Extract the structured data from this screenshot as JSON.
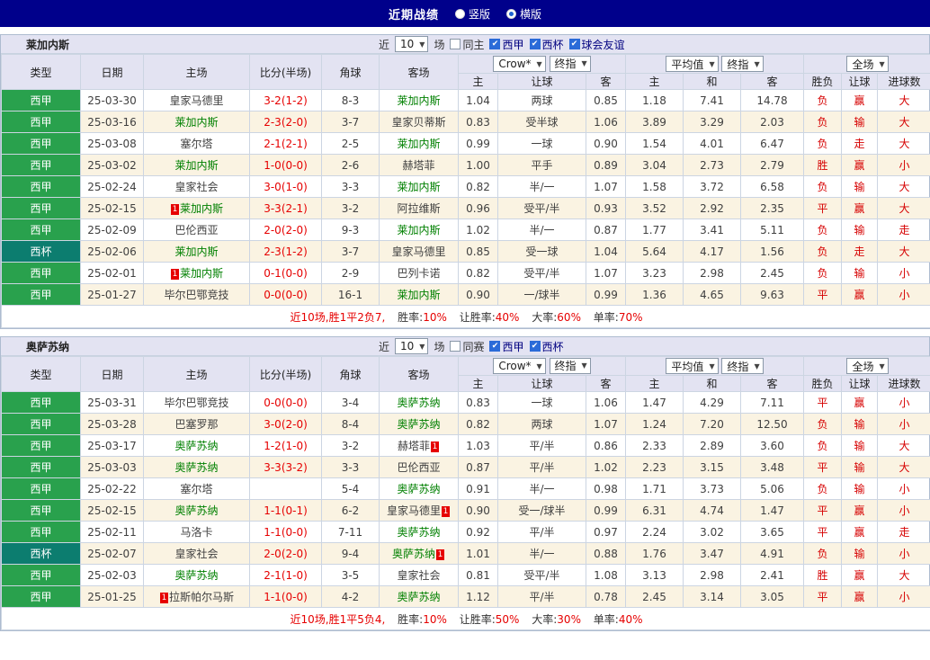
{
  "top_bar": {
    "title": "近期战绩",
    "radio_options": [
      {
        "label": "竖版",
        "selected": false
      },
      {
        "label": "横版",
        "selected": true
      }
    ]
  },
  "icons": {
    "chevron_down": "▼",
    "check": "✔"
  },
  "controls": {
    "recent_prefix": "近",
    "recent_value": "10",
    "recent_suffix": "场",
    "provider_label": "Crow*",
    "final_label": "终指",
    "average_label": "平均值",
    "scope_label": "全场"
  },
  "columns": [
    "类型",
    "日期",
    "主场",
    "比分(半场)",
    "角球",
    "客场",
    "主",
    "让球",
    "客",
    "主",
    "和",
    "客",
    "胜负",
    "让球",
    "进球数"
  ],
  "sections": [
    {
      "team": "莱加内斯",
      "same_label": "同主",
      "leagues": [
        "西甲",
        "西杯",
        "球会友谊"
      ],
      "rows": [
        {
          "league": "西甲",
          "cup": false,
          "date": "25-03-30",
          "home": "皇家马德里",
          "home_focal": false,
          "home_card": "",
          "score": "3-2(1-2)",
          "corners": "8-3",
          "away": "莱加内斯",
          "away_focal": true,
          "away_card": "",
          "odds": [
            "1.04",
            "两球",
            "0.85"
          ],
          "avg": [
            "1.18",
            "7.41",
            "14.78"
          ],
          "outcome": [
            "负",
            "赢",
            "大"
          ]
        },
        {
          "league": "西甲",
          "cup": false,
          "date": "25-03-16",
          "home": "莱加内斯",
          "home_focal": true,
          "home_card": "",
          "score": "2-3(2-0)",
          "corners": "3-7",
          "away": "皇家贝蒂斯",
          "away_focal": false,
          "away_card": "",
          "odds": [
            "0.83",
            "受半球",
            "1.06"
          ],
          "avg": [
            "3.89",
            "3.29",
            "2.03"
          ],
          "outcome": [
            "负",
            "输",
            "大"
          ]
        },
        {
          "league": "西甲",
          "cup": false,
          "date": "25-03-08",
          "home": "塞尔塔",
          "home_focal": false,
          "home_card": "",
          "score": "2-1(2-1)",
          "corners": "2-5",
          "away": "莱加内斯",
          "away_focal": true,
          "away_card": "",
          "odds": [
            "0.99",
            "一球",
            "0.90"
          ],
          "avg": [
            "1.54",
            "4.01",
            "6.47"
          ],
          "outcome": [
            "负",
            "走",
            "大"
          ]
        },
        {
          "league": "西甲",
          "cup": false,
          "date": "25-03-02",
          "home": "莱加内斯",
          "home_focal": true,
          "home_card": "",
          "score": "1-0(0-0)",
          "corners": "2-6",
          "away": "赫塔菲",
          "away_focal": false,
          "away_card": "",
          "odds": [
            "1.00",
            "平手",
            "0.89"
          ],
          "avg": [
            "3.04",
            "2.73",
            "2.79"
          ],
          "outcome": [
            "胜",
            "赢",
            "小"
          ]
        },
        {
          "league": "西甲",
          "cup": false,
          "date": "25-02-24",
          "home": "皇家社会",
          "home_focal": false,
          "home_card": "",
          "score": "3-0(1-0)",
          "corners": "3-3",
          "away": "莱加内斯",
          "away_focal": true,
          "away_card": "",
          "odds": [
            "0.82",
            "半/一",
            "1.07"
          ],
          "avg": [
            "1.58",
            "3.72",
            "6.58"
          ],
          "outcome": [
            "负",
            "输",
            "大"
          ]
        },
        {
          "league": "西甲",
          "cup": false,
          "date": "25-02-15",
          "home": "莱加内斯",
          "home_focal": true,
          "home_card": "1",
          "score": "3-3(2-1)",
          "corners": "3-2",
          "away": "阿拉维斯",
          "away_focal": false,
          "away_card": "",
          "odds": [
            "0.96",
            "受平/半",
            "0.93"
          ],
          "avg": [
            "3.52",
            "2.92",
            "2.35"
          ],
          "outcome": [
            "平",
            "赢",
            "大"
          ]
        },
        {
          "league": "西甲",
          "cup": false,
          "date": "25-02-09",
          "home": "巴伦西亚",
          "home_focal": false,
          "home_card": "",
          "score": "2-0(2-0)",
          "corners": "9-3",
          "away": "莱加内斯",
          "away_focal": true,
          "away_card": "",
          "odds": [
            "1.02",
            "半/一",
            "0.87"
          ],
          "avg": [
            "1.77",
            "3.41",
            "5.11"
          ],
          "outcome": [
            "负",
            "输",
            "走"
          ]
        },
        {
          "league": "西杯",
          "cup": true,
          "date": "25-02-06",
          "home": "莱加内斯",
          "home_focal": true,
          "home_card": "",
          "score": "2-3(1-2)",
          "corners": "3-7",
          "away": "皇家马德里",
          "away_focal": false,
          "away_card": "",
          "odds": [
            "0.85",
            "受一球",
            "1.04"
          ],
          "avg": [
            "5.64",
            "4.17",
            "1.56"
          ],
          "outcome": [
            "负",
            "走",
            "大"
          ]
        },
        {
          "league": "西甲",
          "cup": false,
          "date": "25-02-01",
          "home": "莱加内斯",
          "home_focal": true,
          "home_card": "1",
          "score": "0-1(0-0)",
          "corners": "2-9",
          "away": "巴列卡诺",
          "away_focal": false,
          "away_card": "",
          "odds": [
            "0.82",
            "受平/半",
            "1.07"
          ],
          "avg": [
            "3.23",
            "2.98",
            "2.45"
          ],
          "outcome": [
            "负",
            "输",
            "小"
          ]
        },
        {
          "league": "西甲",
          "cup": false,
          "date": "25-01-27",
          "home": "毕尔巴鄂竞技",
          "home_focal": false,
          "home_card": "",
          "score": "0-0(0-0)",
          "corners": "16-1",
          "away": "莱加内斯",
          "away_focal": true,
          "away_card": "",
          "odds": [
            "0.90",
            "一/球半",
            "0.99"
          ],
          "avg": [
            "1.36",
            "4.65",
            "9.63"
          ],
          "outcome": [
            "平",
            "赢",
            "小"
          ]
        }
      ],
      "summary": {
        "record": "近10场,胜1平2负7,",
        "items": [
          {
            "label": "胜率:",
            "value": "10%"
          },
          {
            "label": "让胜率:",
            "value": "40%"
          },
          {
            "label": "大率:",
            "value": "60%"
          },
          {
            "label": "单率:",
            "value": "70%"
          }
        ]
      }
    },
    {
      "team": "奥萨苏纳",
      "same_label": "同赛",
      "leagues": [
        "西甲",
        "西杯"
      ],
      "rows": [
        {
          "league": "西甲",
          "cup": false,
          "date": "25-03-31",
          "home": "毕尔巴鄂竞技",
          "home_focal": false,
          "home_card": "",
          "score": "0-0(0-0)",
          "corners": "3-4",
          "away": "奥萨苏纳",
          "away_focal": true,
          "away_card": "",
          "odds": [
            "0.83",
            "一球",
            "1.06"
          ],
          "avg": [
            "1.47",
            "4.29",
            "7.11"
          ],
          "outcome": [
            "平",
            "赢",
            "小"
          ]
        },
        {
          "league": "西甲",
          "cup": false,
          "date": "25-03-28",
          "home": "巴塞罗那",
          "home_focal": false,
          "home_card": "",
          "score": "3-0(2-0)",
          "corners": "8-4",
          "away": "奥萨苏纳",
          "away_focal": true,
          "away_card": "",
          "odds": [
            "0.82",
            "两球",
            "1.07"
          ],
          "avg": [
            "1.24",
            "7.20",
            "12.50"
          ],
          "outcome": [
            "负",
            "输",
            "小"
          ]
        },
        {
          "league": "西甲",
          "cup": false,
          "date": "25-03-17",
          "home": "奥萨苏纳",
          "home_focal": true,
          "home_card": "",
          "score": "1-2(1-0)",
          "corners": "3-2",
          "away": "赫塔菲",
          "away_focal": false,
          "away_card": "1",
          "odds": [
            "1.03",
            "平/半",
            "0.86"
          ],
          "avg": [
            "2.33",
            "2.89",
            "3.60"
          ],
          "outcome": [
            "负",
            "输",
            "大"
          ]
        },
        {
          "league": "西甲",
          "cup": false,
          "date": "25-03-03",
          "home": "奥萨苏纳",
          "home_focal": true,
          "home_card": "",
          "score": "3-3(3-2)",
          "corners": "3-3",
          "away": "巴伦西亚",
          "away_focal": false,
          "away_card": "",
          "odds": [
            "0.87",
            "平/半",
            "1.02"
          ],
          "avg": [
            "2.23",
            "3.15",
            "3.48"
          ],
          "outcome": [
            "平",
            "输",
            "大"
          ]
        },
        {
          "league": "西甲",
          "cup": false,
          "date": "25-02-22",
          "home": "塞尔塔",
          "home_focal": false,
          "home_card": "",
          "score": "",
          "corners": "5-4",
          "away": "奥萨苏纳",
          "away_focal": true,
          "away_card": "",
          "odds": [
            "0.91",
            "半/一",
            "0.98"
          ],
          "avg": [
            "1.71",
            "3.73",
            "5.06"
          ],
          "outcome": [
            "负",
            "输",
            "小"
          ]
        },
        {
          "league": "西甲",
          "cup": false,
          "date": "25-02-15",
          "home": "奥萨苏纳",
          "home_focal": true,
          "home_card": "",
          "score": "1-1(0-1)",
          "corners": "6-2",
          "away": "皇家马德里",
          "away_focal": false,
          "away_card": "1",
          "odds": [
            "0.90",
            "受一/球半",
            "0.99"
          ],
          "avg": [
            "6.31",
            "4.74",
            "1.47"
          ],
          "outcome": [
            "平",
            "赢",
            "小"
          ]
        },
        {
          "league": "西甲",
          "cup": false,
          "date": "25-02-11",
          "home": "马洛卡",
          "home_focal": false,
          "home_card": "",
          "score": "1-1(0-0)",
          "corners": "7-11",
          "away": "奥萨苏纳",
          "away_focal": true,
          "away_card": "",
          "odds": [
            "0.92",
            "平/半",
            "0.97"
          ],
          "avg": [
            "2.24",
            "3.02",
            "3.65"
          ],
          "outcome": [
            "平",
            "赢",
            "走"
          ]
        },
        {
          "league": "西杯",
          "cup": true,
          "date": "25-02-07",
          "home": "皇家社会",
          "home_focal": false,
          "home_card": "",
          "score": "2-0(2-0)",
          "corners": "9-4",
          "away": "奥萨苏纳",
          "away_focal": true,
          "away_card": "1",
          "odds": [
            "1.01",
            "半/一",
            "0.88"
          ],
          "avg": [
            "1.76",
            "3.47",
            "4.91"
          ],
          "outcome": [
            "负",
            "输",
            "小"
          ]
        },
        {
          "league": "西甲",
          "cup": false,
          "date": "25-02-03",
          "home": "奥萨苏纳",
          "home_focal": true,
          "home_card": "",
          "score": "2-1(1-0)",
          "corners": "3-5",
          "away": "皇家社会",
          "away_focal": false,
          "away_card": "",
          "odds": [
            "0.81",
            "受平/半",
            "1.08"
          ],
          "avg": [
            "3.13",
            "2.98",
            "2.41"
          ],
          "outcome": [
            "胜",
            "赢",
            "大"
          ]
        },
        {
          "league": "西甲",
          "cup": false,
          "date": "25-01-25",
          "home": "拉斯帕尔马斯",
          "home_focal": false,
          "home_card": "1",
          "score": "1-1(0-0)",
          "corners": "4-2",
          "away": "奥萨苏纳",
          "away_focal": true,
          "away_card": "",
          "odds": [
            "1.12",
            "平/半",
            "0.78"
          ],
          "avg": [
            "2.45",
            "3.14",
            "3.05"
          ],
          "outcome": [
            "平",
            "赢",
            "小"
          ]
        }
      ],
      "summary": {
        "record": "近10场,胜1平5负4,",
        "items": [
          {
            "label": "胜率:",
            "value": "10%"
          },
          {
            "label": "让胜率:",
            "value": "50%"
          },
          {
            "label": "大率:",
            "value": "30%"
          },
          {
            "label": "单率:",
            "value": "40%"
          }
        ]
      }
    }
  ]
}
